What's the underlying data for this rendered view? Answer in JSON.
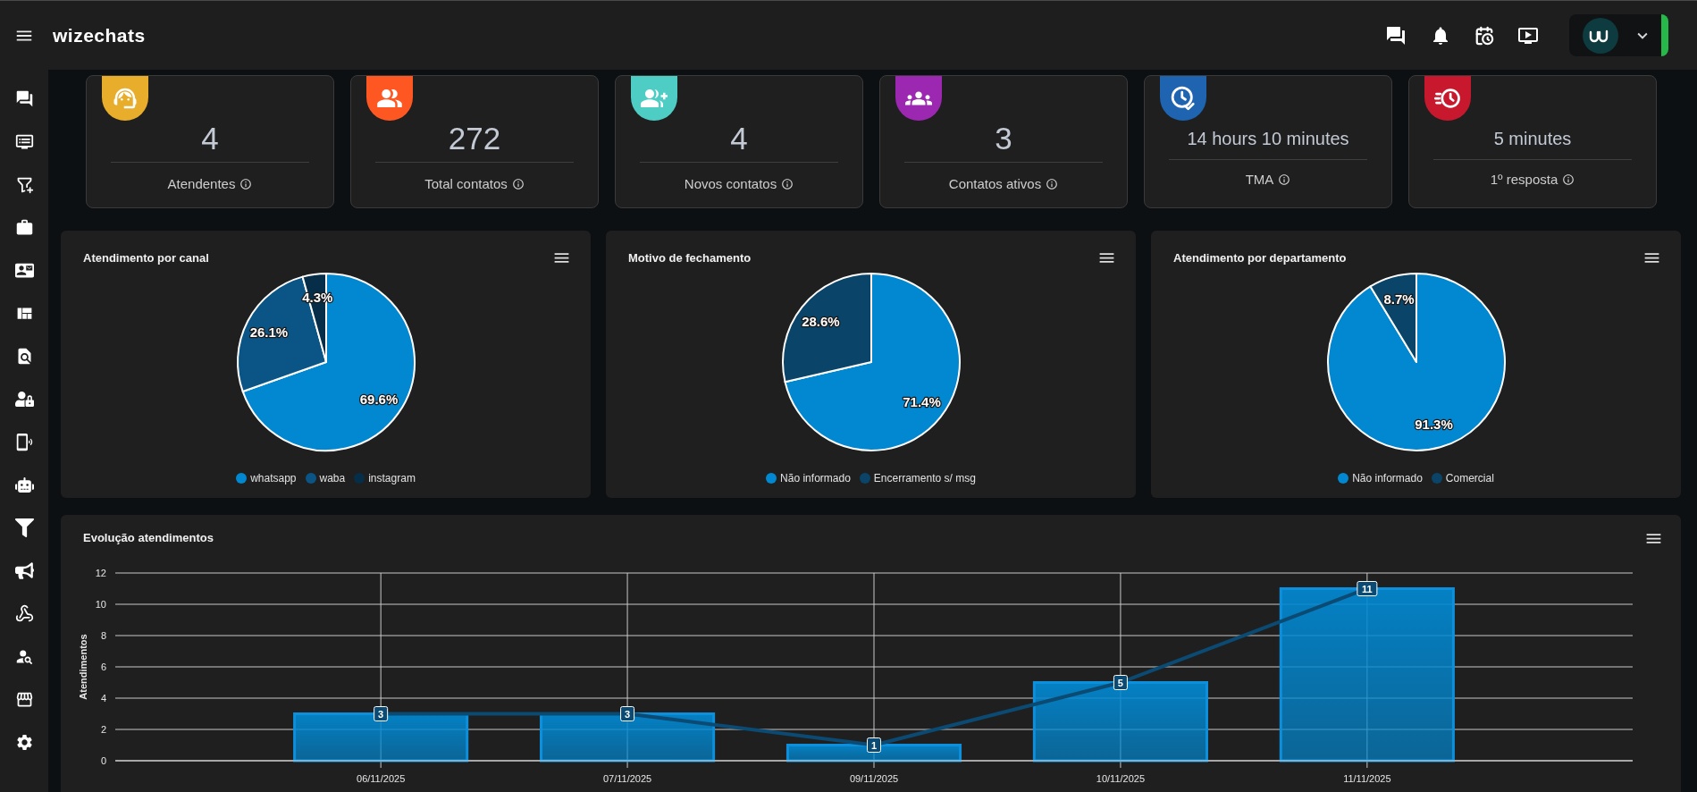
{
  "header": {
    "brand": "wizechats"
  },
  "stats": [
    {
      "kind": "attendants",
      "value": "4",
      "label": "Atendentes",
      "color": "#e8ad2a"
    },
    {
      "kind": "contacts",
      "value": "272",
      "label": "Total contatos",
      "color": "#ff5722"
    },
    {
      "kind": "new_contacts",
      "value": "4",
      "label": "Novos contatos",
      "color": "#4ecdc4"
    },
    {
      "kind": "active_contacts",
      "value": "3",
      "label": "Contatos ativos",
      "color": "#9c27b0"
    },
    {
      "kind": "duration",
      "value": "14 hours 10 minutes",
      "label": "TMA",
      "color": "#1e64b0"
    },
    {
      "kind": "response",
      "value": "5 minutes",
      "label": "1º resposta",
      "color": "#c8182d"
    }
  ],
  "pies": [
    {
      "chart_data": {
        "type": "pie",
        "title": "Atendimento por canal",
        "categories": [
          "whatsapp",
          "waba",
          "instagram"
        ],
        "values": [
          69.6,
          26.1,
          4.3
        ],
        "value_labels": [
          "69.6%",
          "26.1%",
          "4.3%"
        ],
        "legend": "bottom"
      },
      "slices": [
        {
          "color": "#0288d1"
        },
        {
          "color": "#0a5585"
        },
        {
          "color": "#072e48"
        }
      ]
    },
    {
      "chart_data": {
        "type": "pie",
        "title": "Motivo de fechamento",
        "categories": [
          "Não informado",
          "Encerramento s/ msg"
        ],
        "values": [
          71.4,
          28.6
        ],
        "value_labels": [
          "71.4%",
          "28.6%"
        ],
        "legend": "bottom"
      },
      "slices": [
        {
          "color": "#0288d1"
        },
        {
          "color": "#0a4468"
        }
      ]
    },
    {
      "chart_data": {
        "type": "pie",
        "title": "Atendimento por departamento",
        "categories": [
          "Não informado",
          "Comercial"
        ],
        "values": [
          91.3,
          8.7
        ],
        "value_labels": [
          "91.3%",
          "8.7%"
        ],
        "legend": "bottom"
      },
      "slices": [
        {
          "color": "#0288d1"
        },
        {
          "color": "#0a4468"
        }
      ]
    }
  ],
  "evolution": {
    "chart_data": {
      "type": "bar",
      "title": "Evolução atendimentos",
      "ylabel": "Atendimentos",
      "categories": [
        "06/11/2025",
        "07/11/2025",
        "09/11/2025",
        "10/11/2025",
        "11/11/2025"
      ],
      "ylim": [
        0,
        12
      ],
      "yticks": [
        0,
        2,
        4,
        6,
        8,
        10,
        12
      ],
      "grid": "both",
      "series": [
        {
          "type": "bar",
          "color": "#0288d1",
          "values": [
            3,
            3,
            1,
            5,
            11
          ]
        },
        {
          "type": "line",
          "color": "#0b4a72",
          "values": [
            3,
            3,
            1,
            5,
            11
          ],
          "marker": "square",
          "data_labels": true
        }
      ]
    }
  }
}
